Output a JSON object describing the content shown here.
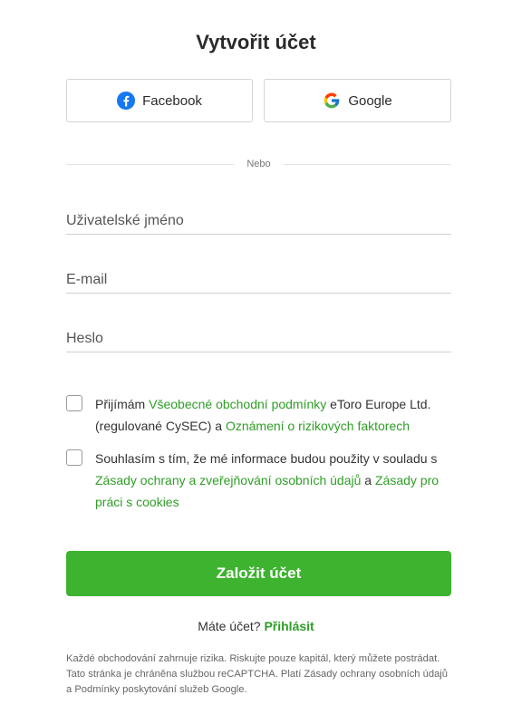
{
  "title": "Vytvořit účet",
  "social": {
    "facebook_label": "Facebook",
    "google_label": "Google"
  },
  "divider_text": "Nebo",
  "fields": {
    "username_placeholder": "Uživatelské jméno",
    "email_placeholder": "E-mail",
    "password_placeholder": "Heslo"
  },
  "consent1": {
    "prefix": "Přijímám ",
    "link1": "Všeobecné obchodní podmínky",
    "middle": " eToro Europe Ltd. (regulované CySEC) a ",
    "link2": "Oznámení o rizikových faktorech"
  },
  "consent2": {
    "prefix": "Souhlasím s tím, že mé informace budou použity v souladu s ",
    "link1": "Zásady ochrany a zveřejňování osobních údajů",
    "middle": " a ",
    "link2": "Zásady pro práci s cookies"
  },
  "submit_label": "Založit účet",
  "login": {
    "question": "Máte účet? ",
    "link": "Přihlásit"
  },
  "disclaimer": "Každé obchodování zahrnuje rizika. Riskujte pouze kapitál, který můžete postrádat. Tato stránka je chráněna službou reCAPTCHA. Platí Zásady ochrany osobních údajů a Podmínky poskytování služeb Google.",
  "colors": {
    "accent_green": "#3db32f",
    "link_green": "#2f9e26",
    "facebook_blue": "#1877f2"
  },
  "icons": {
    "facebook": "facebook-icon",
    "google": "google-icon"
  }
}
